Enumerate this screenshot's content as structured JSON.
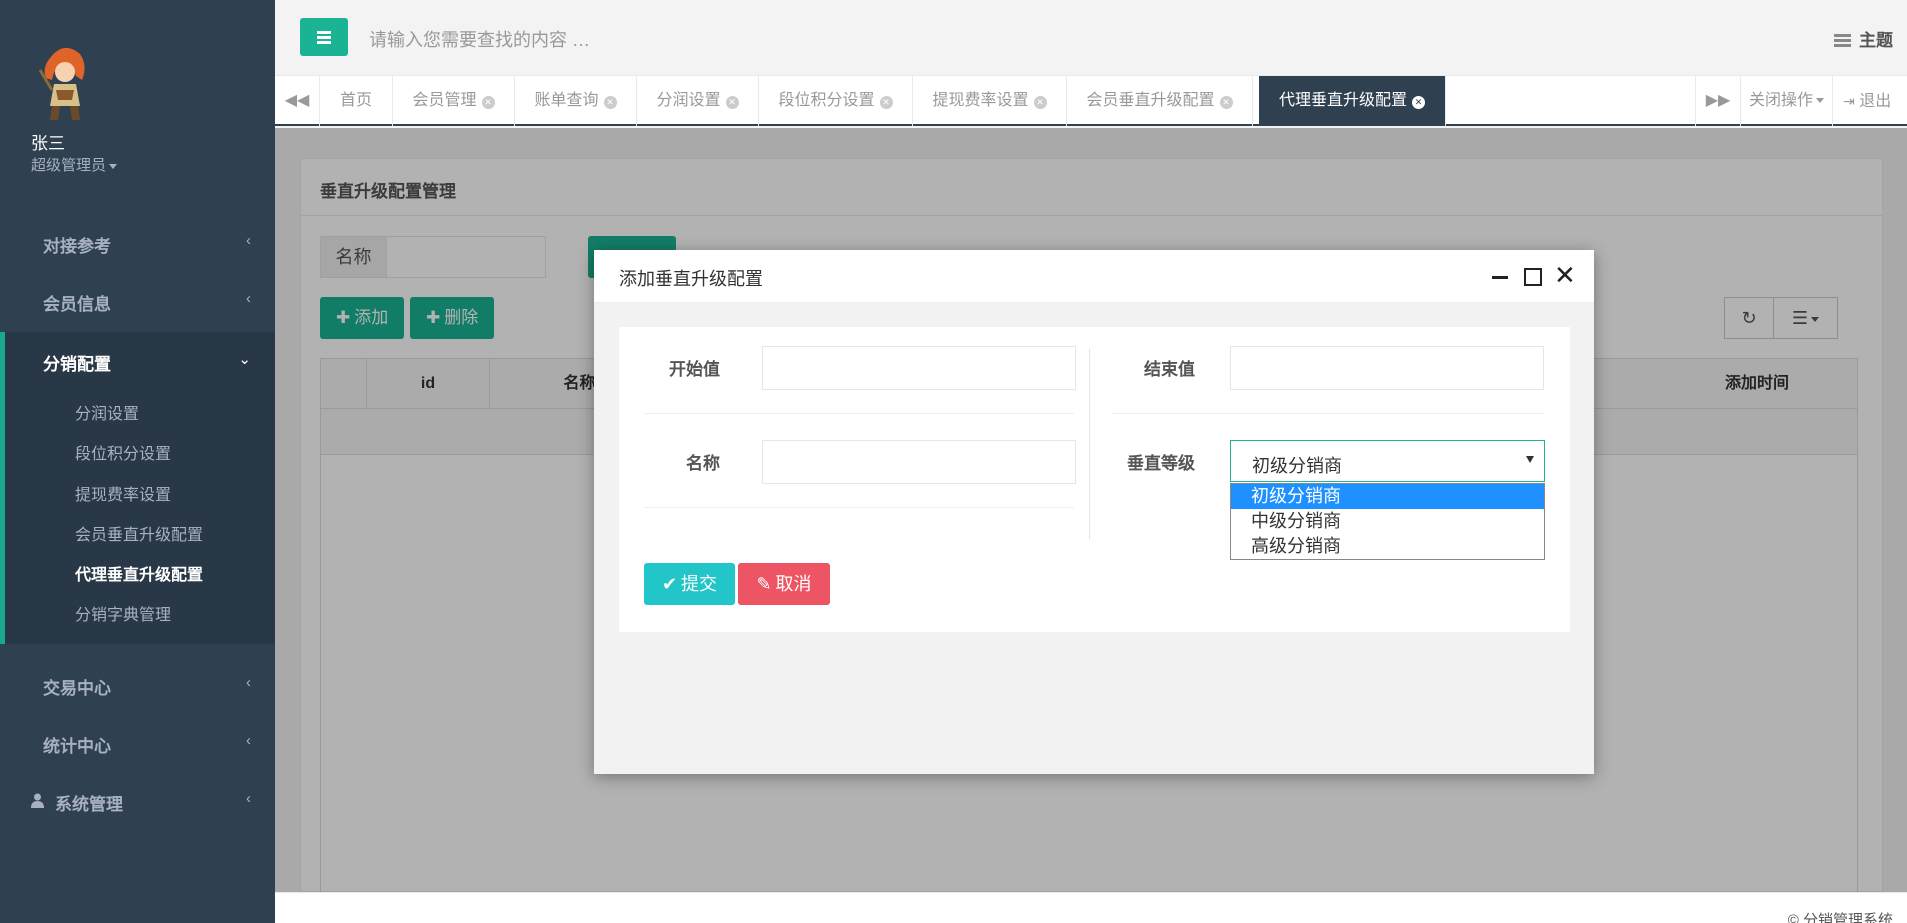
{
  "user": {
    "name": "张三",
    "role": "超级管理员"
  },
  "sidebar": {
    "items": [
      {
        "label": "对接参考"
      },
      {
        "label": "会员信息"
      },
      {
        "label": "分销配置"
      },
      {
        "label": "交易中心"
      },
      {
        "label": "统计中心"
      },
      {
        "label": "系统管理"
      }
    ],
    "sub_items": [
      {
        "label": "分润设置"
      },
      {
        "label": "段位积分设置"
      },
      {
        "label": "提现费率设置"
      },
      {
        "label": "会员垂直升级配置"
      },
      {
        "label": "代理垂直升级配置"
      },
      {
        "label": "分销字典管理"
      }
    ]
  },
  "topbar": {
    "search_placeholder": "请输入您需要查找的内容 …",
    "theme_label": "主题"
  },
  "tabs": [
    {
      "label": "首页"
    },
    {
      "label": "会员管理"
    },
    {
      "label": "账单查询"
    },
    {
      "label": "分润设置"
    },
    {
      "label": "段位积分设置"
    },
    {
      "label": "提现费率设置"
    },
    {
      "label": "会员垂直升级配置"
    },
    {
      "label": "代理垂直升级配置"
    }
  ],
  "tab_actions": {
    "close_ops": "关闭操作",
    "logout": "退出"
  },
  "panel": {
    "title": "垂直升级配置管理",
    "filter_label": "名称",
    "add_label": "添加",
    "delete_label": "删除",
    "columns": [
      "id",
      "名称",
      "添加时间"
    ]
  },
  "modal": {
    "title": "添加垂直升级配置",
    "start_label": "开始值",
    "end_label": "结束值",
    "name_label": "名称",
    "level_label": "垂直等级",
    "level_selected": "初级分销商",
    "level_options": [
      "初级分销商",
      "中级分销商",
      "高级分销商"
    ],
    "submit_label": "提交",
    "cancel_label": "取消"
  },
  "footer": {
    "text": "© 分销管理系统"
  },
  "colors": {
    "sidebar": "#2f4050",
    "accent": "#1ab394",
    "info": "#23c6c8",
    "danger": "#ed5565"
  }
}
